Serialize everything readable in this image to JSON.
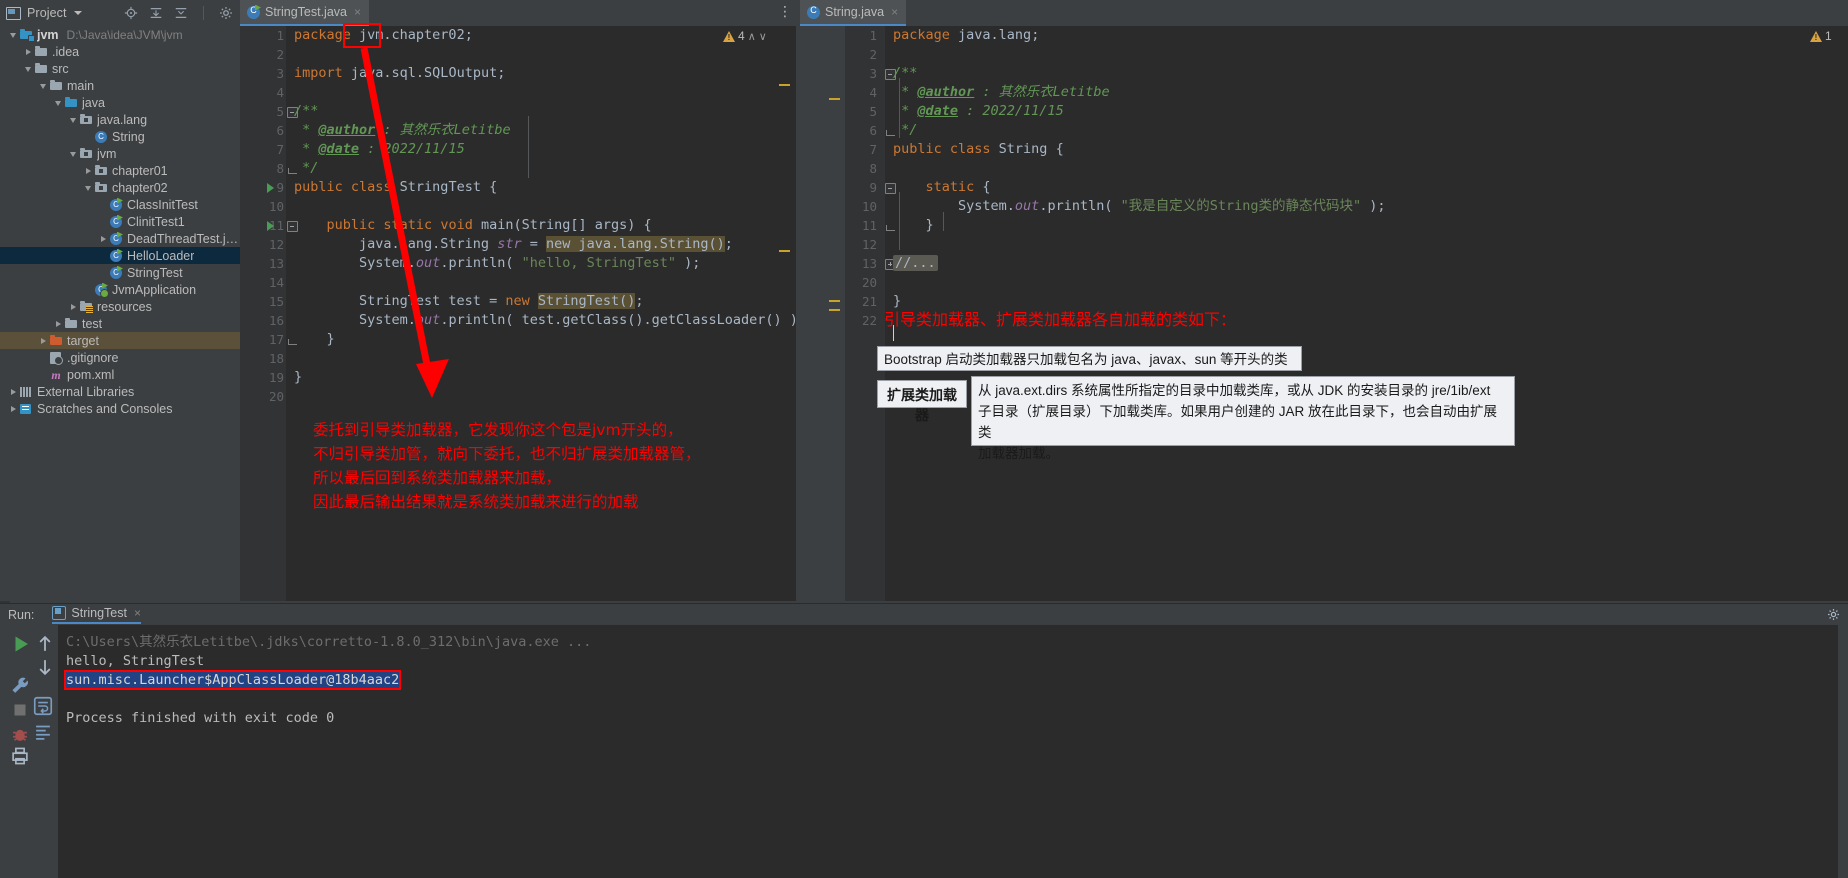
{
  "app": {
    "theme_bg": "#3c3f41",
    "editor_bg": "#2b2b2b",
    "accent": "#4a88c7",
    "annotation_color": "#fe0000"
  },
  "toolbar": {
    "project_label": "Project",
    "icons": [
      "locate-icon",
      "expand-all-icon",
      "collapse-all-icon",
      "gear-icon",
      "minimize-icon"
    ]
  },
  "tabs": [
    {
      "label": "StringTest.java",
      "selected": true,
      "close": "×"
    },
    {
      "label": "String.java",
      "selected": true,
      "close": "×"
    }
  ],
  "project_tree": {
    "root_path": "D:\\Java\\idea\\JVM\\jvm",
    "items": [
      {
        "label": "jvm",
        "depth": 0,
        "arrow": "down",
        "icon": "module-folder-icon",
        "path": "D:\\Java\\idea\\JVM\\jvm",
        "bold": true
      },
      {
        "label": ".idea",
        "depth": 1,
        "arrow": "right",
        "icon": "folder-icon"
      },
      {
        "label": "src",
        "depth": 1,
        "arrow": "down",
        "icon": "folder-icon"
      },
      {
        "label": "main",
        "depth": 2,
        "arrow": "down",
        "icon": "folder-icon"
      },
      {
        "label": "java",
        "depth": 3,
        "arrow": "down",
        "icon": "source-folder-icon"
      },
      {
        "label": "java.lang",
        "depth": 4,
        "arrow": "down",
        "icon": "package-icon"
      },
      {
        "label": "String",
        "depth": 5,
        "arrow": "none",
        "icon": "class-icon"
      },
      {
        "label": "jvm",
        "depth": 4,
        "arrow": "down",
        "icon": "package-icon"
      },
      {
        "label": "chapter01",
        "depth": 5,
        "arrow": "right",
        "icon": "package-icon"
      },
      {
        "label": "chapter02",
        "depth": 5,
        "arrow": "down",
        "icon": "package-icon"
      },
      {
        "label": "ClassInitTest",
        "depth": 6,
        "arrow": "none",
        "icon": "java-class-icon"
      },
      {
        "label": "ClinitTest1",
        "depth": 6,
        "arrow": "none",
        "icon": "java-class-icon"
      },
      {
        "label": "DeadThreadTest.java",
        "depth": 6,
        "arrow": "right",
        "icon": "java-class-icon"
      },
      {
        "label": "HelloLoader",
        "depth": 6,
        "arrow": "none",
        "icon": "java-class-icon",
        "selected": true
      },
      {
        "label": "StringTest",
        "depth": 6,
        "arrow": "none",
        "icon": "java-class-icon"
      },
      {
        "label": "JvmApplication",
        "depth": 5,
        "arrow": "none",
        "icon": "spring-class-icon"
      },
      {
        "label": "resources",
        "depth": 4,
        "arrow": "right",
        "icon": "resources-folder-icon"
      },
      {
        "label": "test",
        "depth": 3,
        "arrow": "right",
        "icon": "folder-icon"
      },
      {
        "label": "target",
        "depth": 2,
        "arrow": "right",
        "icon": "excluded-folder-icon",
        "highlight": true
      },
      {
        "label": ".gitignore",
        "depth": 2,
        "arrow": "none",
        "icon": "gitignore-icon"
      },
      {
        "label": "pom.xml",
        "depth": 2,
        "arrow": "none",
        "icon": "maven-icon"
      },
      {
        "label": "External Libraries",
        "depth": 0,
        "arrow": "right",
        "icon": "library-icon"
      },
      {
        "label": "Scratches and Consoles",
        "depth": 0,
        "arrow": "right",
        "icon": "scratches-icon"
      }
    ]
  },
  "editor_left": {
    "filename": "StringTest.java",
    "warnings": {
      "count": "4",
      "up": "∧",
      "down": "∨"
    },
    "lines": [
      {
        "n": 1,
        "segments": [
          {
            "t": "package ",
            "c": "kw"
          },
          {
            "t": "jvm.chapter02",
            "c": "loc"
          },
          {
            "t": ";",
            "c": "brace"
          }
        ]
      },
      {
        "n": 2,
        "segments": []
      },
      {
        "n": 3,
        "segments": [
          {
            "t": "import ",
            "c": "kw"
          },
          {
            "t": "java.sql.SQLOutput",
            "c": "loc"
          },
          {
            "t": ";",
            "c": "brace"
          }
        ]
      },
      {
        "n": 4,
        "segments": []
      },
      {
        "n": 5,
        "segments": [
          {
            "t": "/**",
            "c": "cmt"
          }
        ],
        "fold": "open"
      },
      {
        "n": 6,
        "segments": [
          {
            "t": " * ",
            "c": "cmt"
          },
          {
            "t": "@author",
            "c": "cmtag"
          },
          {
            "t": " : 其然乐衣Letitbe",
            "c": "cmt"
          }
        ]
      },
      {
        "n": 7,
        "segments": [
          {
            "t": " * ",
            "c": "cmt"
          },
          {
            "t": "@date",
            "c": "cmtag"
          },
          {
            "t": " : 2022/11/15",
            "c": "cmt"
          }
        ]
      },
      {
        "n": 8,
        "segments": [
          {
            "t": " */",
            "c": "cmt"
          }
        ],
        "fold": "close"
      },
      {
        "n": 9,
        "segments": [
          {
            "t": "public class ",
            "c": "kw"
          },
          {
            "t": "StringTest",
            "c": "loc"
          },
          {
            "t": " {",
            "c": "brace"
          }
        ],
        "run": true
      },
      {
        "n": 10,
        "segments": []
      },
      {
        "n": 11,
        "segments": [
          {
            "t": "    ",
            "c": "loc"
          },
          {
            "t": "public static ",
            "c": "kw"
          },
          {
            "t": "void ",
            "c": "kw"
          },
          {
            "t": "main",
            "c": "mth"
          },
          {
            "t": "(String[] args) {",
            "c": "loc"
          }
        ],
        "run": true,
        "fold": "open"
      },
      {
        "n": 12,
        "segments": [
          {
            "t": "        java.lang.String ",
            "c": "loc"
          },
          {
            "t": "str",
            "c": "fld"
          },
          {
            "t": " = ",
            "c": "loc"
          },
          {
            "t": "new java.lang.String()",
            "c": "hl"
          },
          {
            "t": ";",
            "c": "brace"
          }
        ]
      },
      {
        "n": 13,
        "segments": [
          {
            "t": "        System.",
            "c": "loc"
          },
          {
            "t": "out",
            "c": "fld"
          },
          {
            "t": ".println( ",
            "c": "loc"
          },
          {
            "t": "\"hello, StringTest\"",
            "c": "str"
          },
          {
            "t": " );",
            "c": "loc"
          }
        ]
      },
      {
        "n": 14,
        "segments": []
      },
      {
        "n": 15,
        "segments": [
          {
            "t": "        StringTest test = ",
            "c": "loc"
          },
          {
            "t": "new ",
            "c": "kw"
          },
          {
            "t": "StringTest()",
            "c": "hl"
          },
          {
            "t": ";",
            "c": "brace"
          }
        ]
      },
      {
        "n": 16,
        "segments": [
          {
            "t": "        System.",
            "c": "loc"
          },
          {
            "t": "out",
            "c": "fld"
          },
          {
            "t": ".println( test.getClass().getClassLoader() );",
            "c": "loc"
          }
        ]
      },
      {
        "n": 17,
        "segments": [
          {
            "t": "    }",
            "c": "brace"
          }
        ],
        "fold": "close"
      },
      {
        "n": 18,
        "segments": []
      },
      {
        "n": 19,
        "segments": [
          {
            "t": "}",
            "c": "brace"
          }
        ]
      },
      {
        "n": 20,
        "segments": []
      }
    ],
    "annotation": [
      "委托到引导类加载器，它发现你这个包是jvm开头的，",
      "不归引导类加管，就向下委托，也不归扩展类加载器管，",
      "所以最后回到系统类加载器来加载，",
      "因此最后输出结果就是系统类加载来进行的加载"
    ]
  },
  "editor_right": {
    "filename": "String.java",
    "warnings": {
      "count": "1"
    },
    "lines": [
      {
        "n": 1,
        "segments": [
          {
            "t": "package ",
            "c": "kw"
          },
          {
            "t": "java.lang",
            "c": "loc"
          },
          {
            "t": ";",
            "c": "brace"
          }
        ]
      },
      {
        "n": 2,
        "segments": []
      },
      {
        "n": 3,
        "segments": [
          {
            "t": "/**",
            "c": "cmt"
          }
        ],
        "fold": "open"
      },
      {
        "n": 4,
        "segments": [
          {
            "t": " * ",
            "c": "cmt"
          },
          {
            "t": "@author",
            "c": "cmtag"
          },
          {
            "t": " : 其然乐衣Letitbe",
            "c": "cmt"
          }
        ]
      },
      {
        "n": 5,
        "segments": [
          {
            "t": " * ",
            "c": "cmt"
          },
          {
            "t": "@date",
            "c": "cmtag"
          },
          {
            "t": " : 2022/11/15",
            "c": "cmt"
          }
        ]
      },
      {
        "n": 6,
        "segments": [
          {
            "t": " */",
            "c": "cmt"
          }
        ],
        "fold": "close"
      },
      {
        "n": 7,
        "segments": [
          {
            "t": "public class ",
            "c": "kw"
          },
          {
            "t": "String",
            "c": "loc"
          },
          {
            "t": " {",
            "c": "brace"
          }
        ]
      },
      {
        "n": 8,
        "segments": []
      },
      {
        "n": 9,
        "segments": [
          {
            "t": "    ",
            "c": "loc"
          },
          {
            "t": "static ",
            "c": "kw"
          },
          {
            "t": "{",
            "c": "brace"
          }
        ],
        "fold": "open"
      },
      {
        "n": 10,
        "segments": [
          {
            "t": "        System.",
            "c": "loc"
          },
          {
            "t": "out",
            "c": "fld"
          },
          {
            "t": ".println( ",
            "c": "loc"
          },
          {
            "t": "\"我是自定义的String类的静态代码块\"",
            "c": "str"
          },
          {
            "t": " );",
            "c": "loc"
          }
        ]
      },
      {
        "n": 11,
        "segments": [
          {
            "t": "    }",
            "c": "brace"
          }
        ],
        "fold": "close"
      },
      {
        "n": 12,
        "segments": []
      },
      {
        "n": 13,
        "segments": [
          {
            "t": "//...",
            "c": "foldbadge"
          }
        ],
        "fold": "plus"
      },
      {
        "n": 20,
        "segments": []
      },
      {
        "n": 21,
        "segments": [
          {
            "t": "}",
            "c": "brace"
          }
        ]
      },
      {
        "n": 22,
        "segments": []
      }
    ],
    "annotation_title": "引导类加载器、扩展类加载器各自加载的类如下：",
    "bootstrap_box": "Bootstrap 启动类加载器只加载包名为 java、javax、sun 等开头的类",
    "ext_label": "扩展类加载器",
    "ext_box": [
      "从 java.ext.dirs 系统属性所指定的目录中加载类库，或从 JDK 的安装目录的 jre/1ib/ext",
      "子目录（扩展目录）下加载类库。如果用户创建的 JAR 放在此目录下，也会自动由扩展类",
      "加载器加载。"
    ]
  },
  "run_panel": {
    "run_label": "Run:",
    "config_name": "StringTest",
    "close": "×",
    "console_lines": [
      {
        "text": "C:\\Users\\其然乐衣Letitbe\\.jdks\\corretto-1.8.0_312\\bin\\java.exe ...",
        "style": "path"
      },
      {
        "text": "hello, StringTest",
        "style": "normal"
      },
      {
        "text": "sun.misc.Launcher$AppClassLoader@18b4aac2",
        "style": "selected"
      },
      {
        "text": "",
        "style": "normal"
      },
      {
        "text": "Process finished with exit code 0",
        "style": "normal"
      }
    ],
    "tool_icons": [
      "run-icon",
      "up-arrow-icon",
      "down-arrow-icon",
      "wrench-icon",
      "soft-wrap-icon",
      "stop-icon",
      "scroll-end-icon",
      "bug-icon",
      "print-icon",
      "trash-icon"
    ]
  }
}
